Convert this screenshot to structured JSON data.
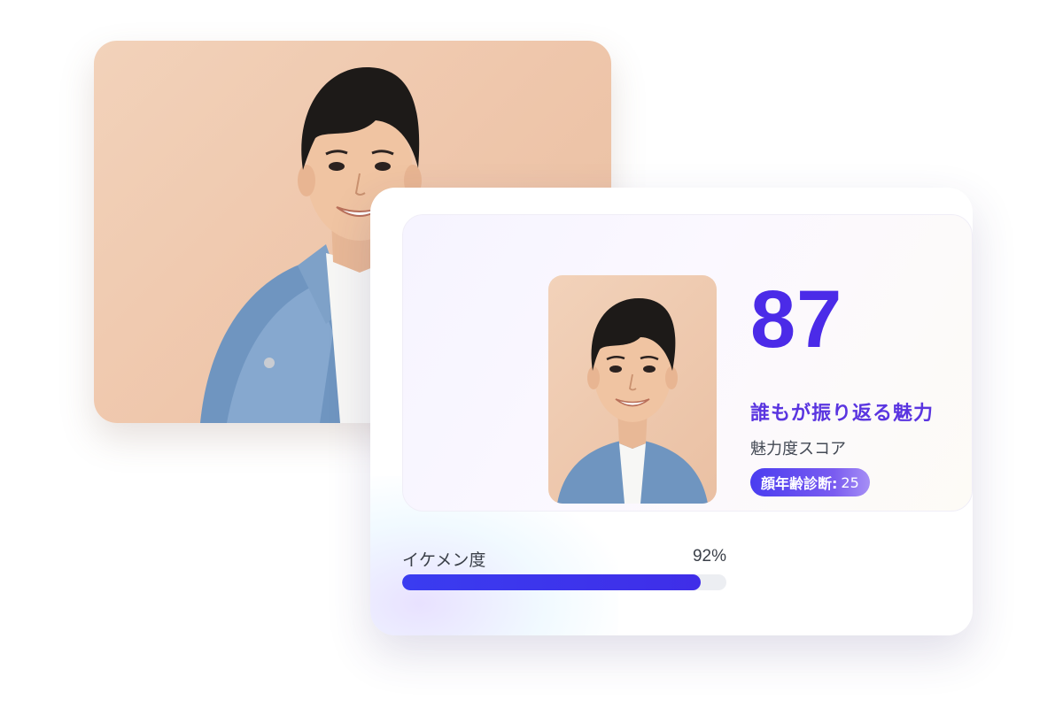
{
  "photo_card": {
    "background_colors": [
      "#f2d2ba",
      "#e9bea0"
    ],
    "subject_icon": "person-portrait-icon"
  },
  "result": {
    "score": "87",
    "tagline": "誰もが振り返る魅力",
    "score_label": "魅力度スコア",
    "age_badge": {
      "label": "顔年齢診断:",
      "value": "25"
    },
    "thumbnail_icon": "person-portrait-icon"
  },
  "metrics": [
    {
      "label": "イケメン度",
      "percent_text": "92%",
      "fraction": 0.92
    }
  ],
  "colors": {
    "accent": "#4b2be8",
    "tagline": "#5a35e0",
    "bar_fill": "#3a3cf0",
    "bar_track": "#eceef2"
  }
}
